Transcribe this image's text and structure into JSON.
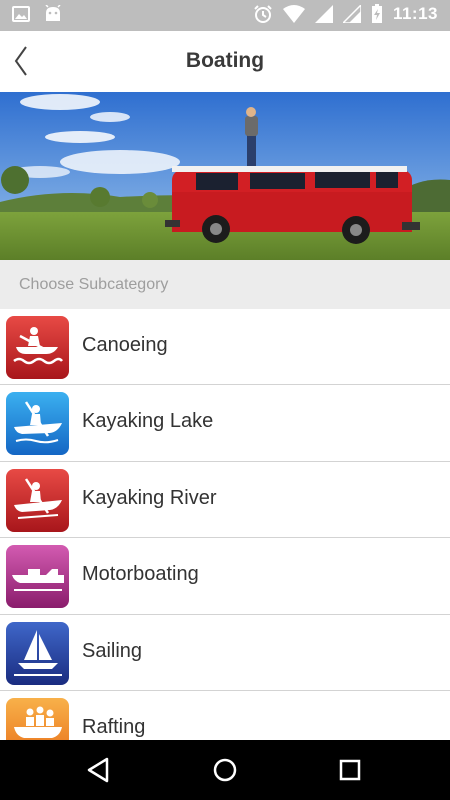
{
  "status_bar": {
    "time": "11:13"
  },
  "header": {
    "title": "Boating"
  },
  "section": {
    "label": "Choose Subcategory"
  },
  "subcategories": [
    {
      "label": "Canoeing",
      "icon": "canoe-icon",
      "color": "#c62828"
    },
    {
      "label": "Kayaking Lake",
      "icon": "kayak-lake-icon",
      "color": "#1e88e5"
    },
    {
      "label": "Kayaking River",
      "icon": "kayak-river-icon",
      "color": "#c62828"
    },
    {
      "label": "Motorboating",
      "icon": "motorboat-icon",
      "color": "#a1287a"
    },
    {
      "label": "Sailing",
      "icon": "sailboat-icon",
      "color": "#283593"
    },
    {
      "label": "Rafting",
      "icon": "raft-icon",
      "color": "#f08a1c"
    }
  ]
}
